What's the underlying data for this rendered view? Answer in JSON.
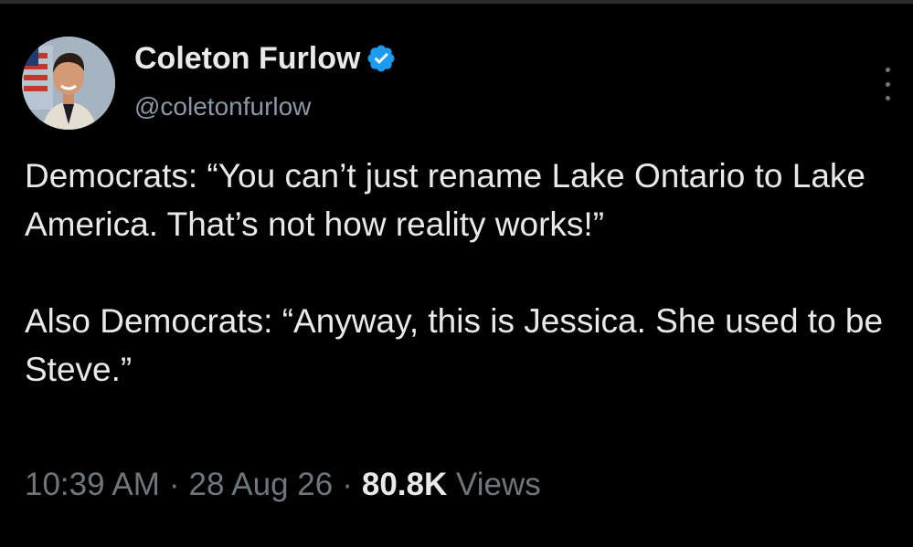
{
  "author": {
    "display_name": "Coleton Furlow",
    "handle": "@coletonfurlow",
    "verified": true,
    "verified_color": "#1d9bf0",
    "avatar_icon": "profile-photo"
  },
  "tweet": {
    "text": "Democrats: “You can’t just rename Lake Ontario to Lake America. That’s not how reality works!”\n\nAlso Democrats: “Anyway, this is Jessica. She used to be Steve.”"
  },
  "meta": {
    "time": "10:39 AM",
    "separator": "·",
    "date": "28 Aug 26",
    "views_count": "80.8K",
    "views_label": "Views"
  },
  "icons": {
    "more": "more-vertical-icon",
    "verified": "verified-badge-icon"
  },
  "colors": {
    "background": "#000000",
    "text": "#e7e9ea",
    "secondary_text": "#8b98a5",
    "meta_text": "#6e767d"
  }
}
